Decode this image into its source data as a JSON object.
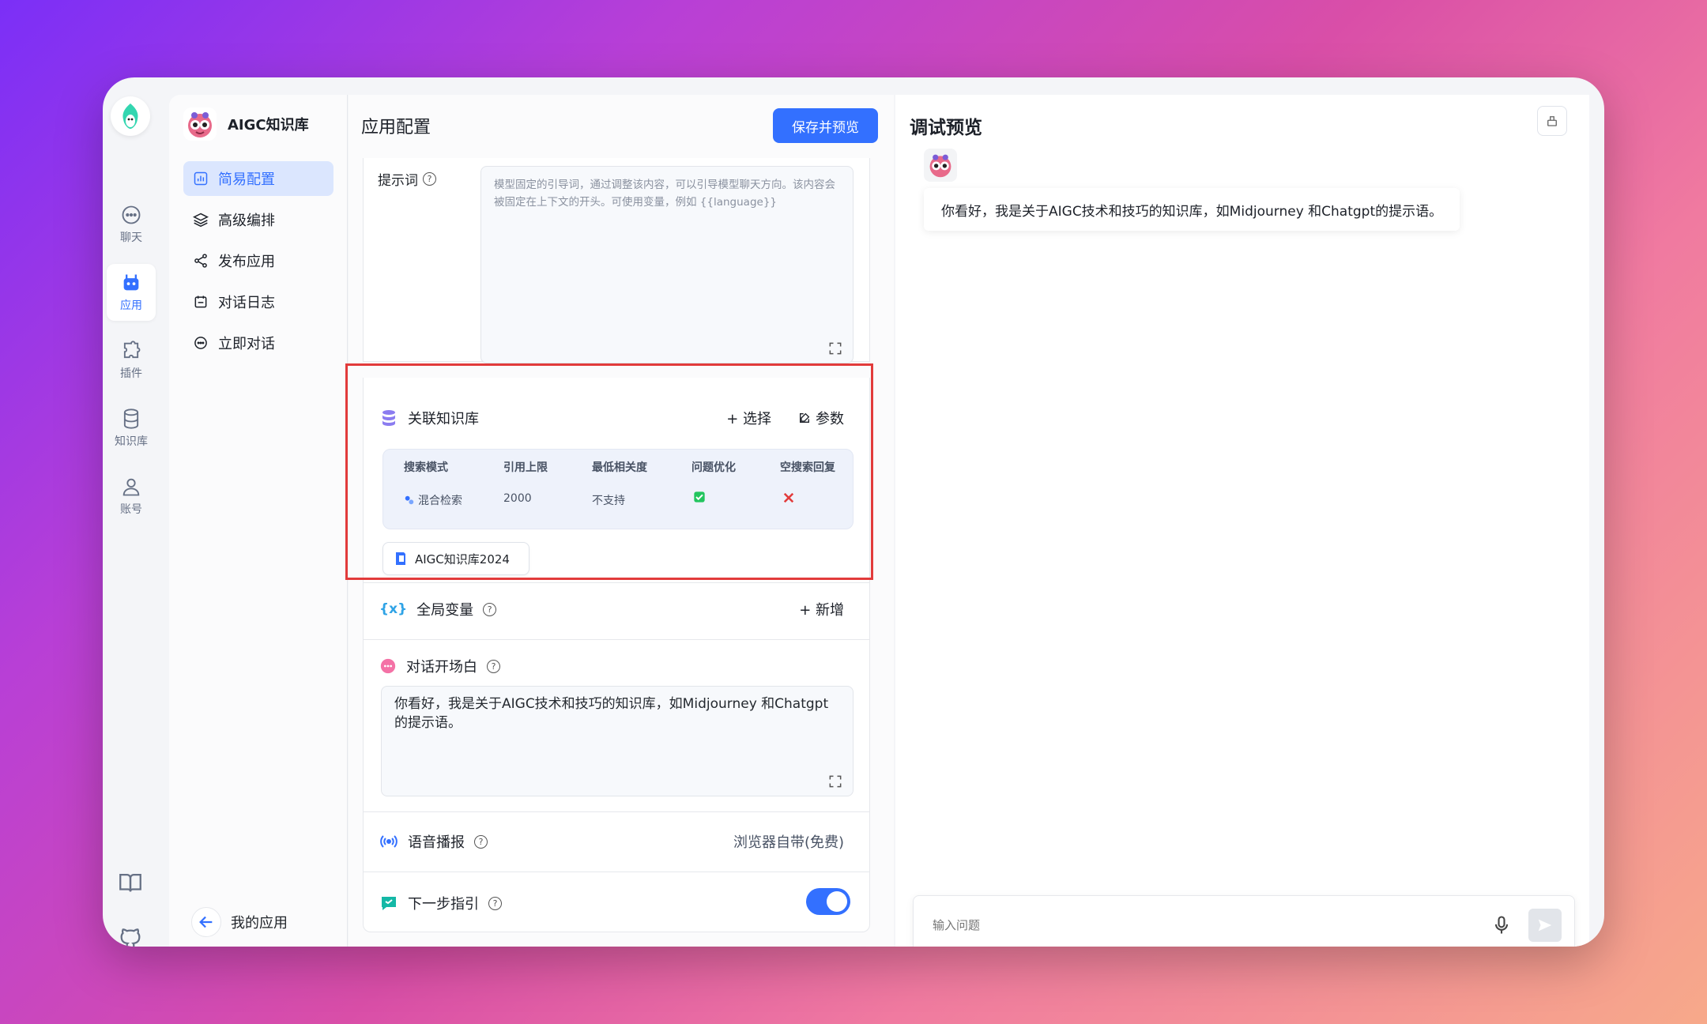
{
  "rail": {
    "items": [
      {
        "label": "聊天",
        "icon": "chat-icon"
      },
      {
        "label": "应用",
        "icon": "robot-icon"
      },
      {
        "label": "插件",
        "icon": "puzzle-icon"
      },
      {
        "label": "知识库",
        "icon": "database-icon"
      },
      {
        "label": "账号",
        "icon": "user-icon"
      }
    ]
  },
  "nav": {
    "title": "AIGC知识库",
    "items": [
      {
        "label": "简易配置",
        "icon": "chart-icon"
      },
      {
        "label": "高级编排",
        "icon": "layers-icon"
      },
      {
        "label": "发布应用",
        "icon": "share-icon"
      },
      {
        "label": "对话日志",
        "icon": "calendar-icon"
      },
      {
        "label": "立即对话",
        "icon": "chat-icon"
      }
    ],
    "back_label": "我的应用"
  },
  "config": {
    "title": "应用配置",
    "save_label": "保存并预览",
    "prompt": {
      "label": "提示词",
      "placeholder": "模型固定的引导词，通过调整该内容，可以引导模型聊天方向。该内容会被固定在上下文的开头。可使用变量，例如 {{language}}"
    },
    "kb": {
      "label": "关联知识库",
      "select_label": "+ 选择",
      "params_label": "参数",
      "headers": [
        "搜索模式",
        "引用上限",
        "最低相关度",
        "问题优化",
        "空搜索回复"
      ],
      "row": {
        "mode": "混合检索",
        "limit": "2000",
        "min_relevance": "不支持"
      },
      "chip": "AIGC知识库2024"
    },
    "vars": {
      "label": "全局变量",
      "add_label": "+ 新增"
    },
    "opening": {
      "label": "对话开场白",
      "text": "你看好，我是关于AIGC技术和技巧的知识库，如Midjourney 和Chatgpt的提示语。"
    },
    "voice": {
      "label": "语音播报",
      "value": "浏览器自带(免费)"
    },
    "next": {
      "label": "下一步指引"
    }
  },
  "preview": {
    "title": "调试预览",
    "message": "你看好，我是关于AIGC技术和技巧的知识库，如Midjourney 和Chatgpt的提示语。",
    "input_placeholder": "输入问题"
  },
  "colors": {
    "accent": "#3370ff",
    "highlight": "#e23b3b",
    "check": "#22c55e",
    "cross": "#e23b3b"
  }
}
